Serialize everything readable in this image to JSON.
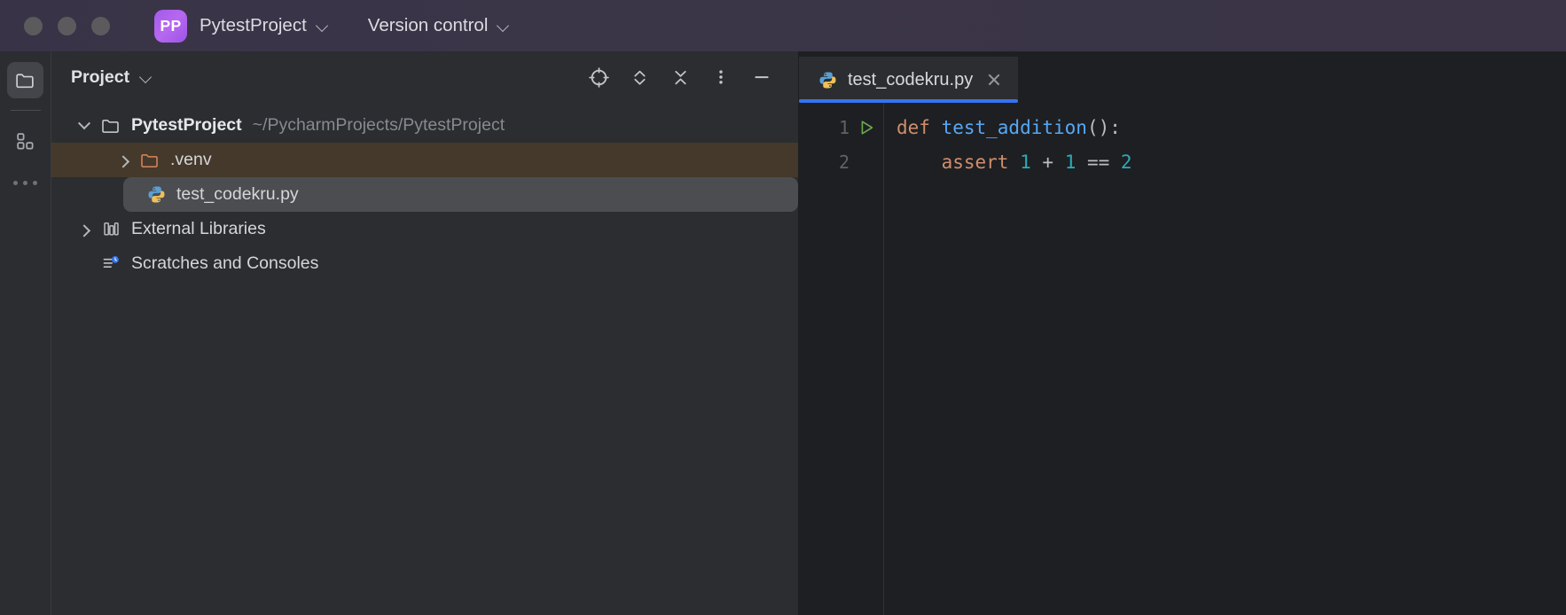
{
  "titlebar": {
    "badge": "PP",
    "project_name": "PytestProject",
    "vcs_label": "Version control",
    "badge_color": "#a35bea",
    "chevron_icon": "chevron-down-icon"
  },
  "rail": {
    "items": [
      {
        "icon": "project-folder-icon",
        "name": "project",
        "active": true
      },
      {
        "icon": "structure-squares-icon",
        "name": "structure",
        "active": false
      },
      {
        "icon": "more-dots-icon",
        "name": "more-tool-windows",
        "active": false
      }
    ]
  },
  "panel": {
    "title": "Project",
    "tools": [
      {
        "icon": "crosshair-target-icon",
        "label": "Select Opened File"
      },
      {
        "icon": "expand-all-icon",
        "label": "Expand All"
      },
      {
        "icon": "collapse-all-icon",
        "label": "Collapse All"
      },
      {
        "icon": "more-vertical-dots-icon",
        "label": "Options"
      },
      {
        "icon": "minimize-icon",
        "label": "Hide"
      }
    ]
  },
  "tree": {
    "nodes": [
      {
        "label": "PytestProject",
        "path": "~/PycharmProjects/PytestProject",
        "icon": "folder-icon",
        "arrow": "chevron-down-icon",
        "bold": true,
        "level": 0,
        "state": "normal"
      },
      {
        "label": ".venv",
        "path": "",
        "icon": "folder-orange-icon",
        "arrow": "chevron-right-icon",
        "bold": false,
        "level": 1,
        "state": "excluded"
      },
      {
        "label": "test_codekru.py",
        "path": "",
        "icon": "python-file-icon",
        "arrow": "",
        "bold": false,
        "level": 1,
        "state": "selected"
      },
      {
        "label": "External Libraries",
        "path": "",
        "icon": "library-icon",
        "arrow": "chevron-right-icon",
        "bold": false,
        "level": 0,
        "state": "normal"
      },
      {
        "label": "Scratches and Consoles",
        "path": "",
        "icon": "scratches-icon",
        "arrow": "",
        "bold": false,
        "level": 0,
        "state": "normal"
      }
    ]
  },
  "editor": {
    "tab": {
      "label": "test_codekru.py",
      "icon": "python-file-icon",
      "close_icon": "close-icon",
      "active_underline_color": "#3574f0"
    },
    "lines": [
      {
        "number": "1",
        "gutter_icon": "run-test-icon",
        "tokens": [
          {
            "t": "def ",
            "c": "keyword"
          },
          {
            "t": "test_addition",
            "c": "function"
          },
          {
            "t": "():",
            "c": "plain"
          }
        ]
      },
      {
        "number": "2",
        "gutter_icon": "",
        "tokens": [
          {
            "t": "    ",
            "c": "plain"
          },
          {
            "t": "assert ",
            "c": "keyword"
          },
          {
            "t": "1",
            "c": "number"
          },
          {
            "t": " + ",
            "c": "plain"
          },
          {
            "t": "1",
            "c": "number"
          },
          {
            "t": " == ",
            "c": "plain"
          },
          {
            "t": "2",
            "c": "number"
          }
        ]
      }
    ],
    "colors": {
      "keyword": "#cf8e6d",
      "function": "#56a8f5",
      "number": "#2aacb8",
      "plain": "#bcbec4",
      "background": "#1e1f22"
    }
  }
}
